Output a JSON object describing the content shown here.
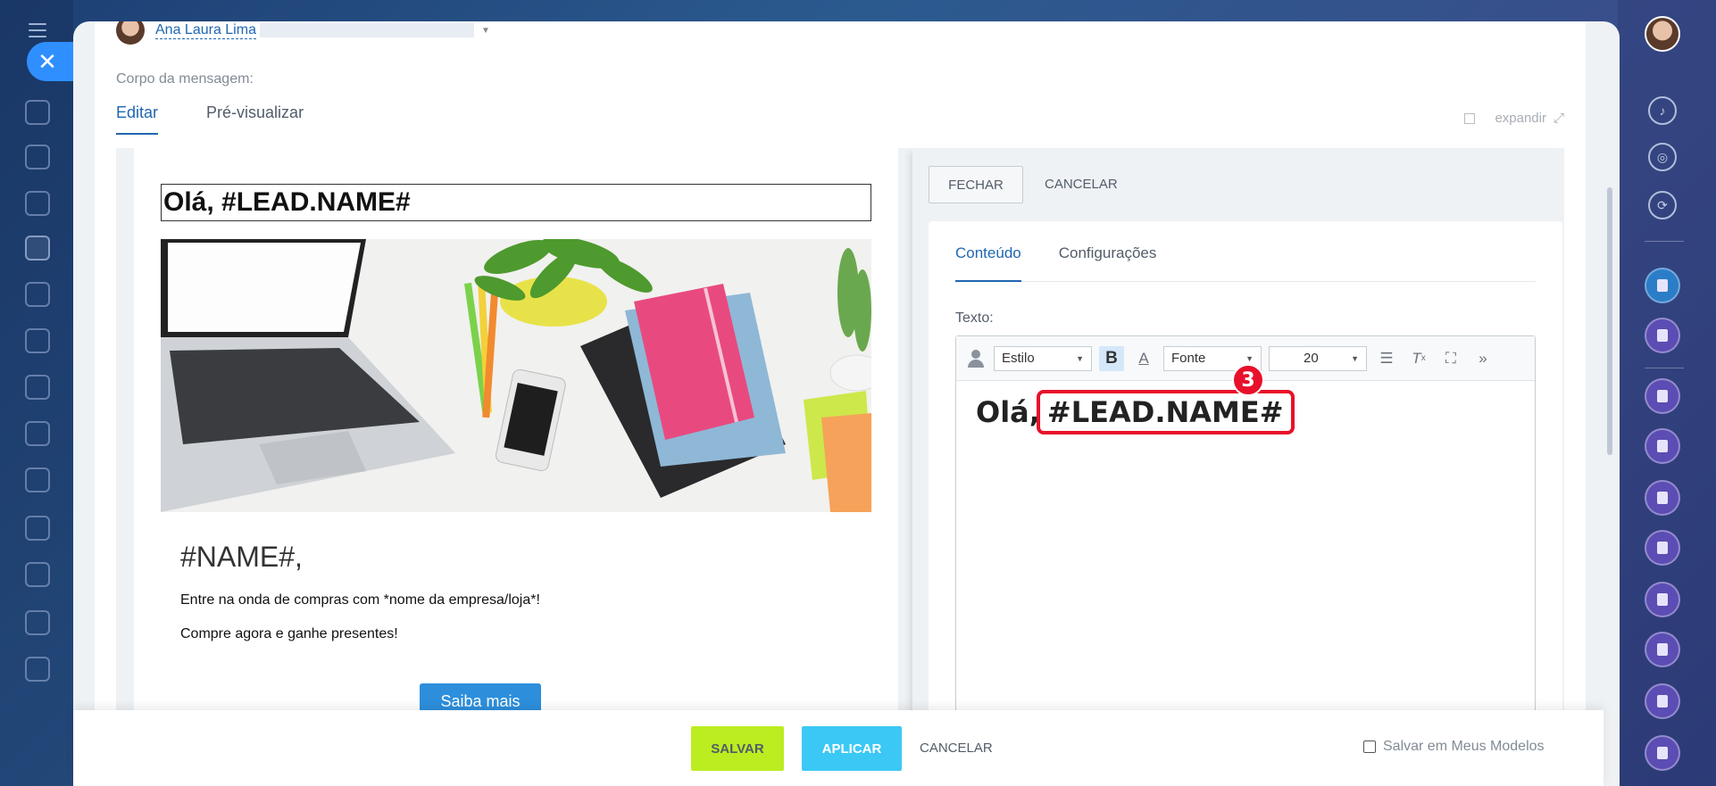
{
  "sender": {
    "name": "Ana Laura Lima"
  },
  "message": {
    "body_label": "Corpo da mensagem:",
    "tabs": [
      {
        "label": "Editar"
      },
      {
        "label": "Pré-visualizar"
      }
    ],
    "expand_label": "expandir"
  },
  "email": {
    "heading": "Olá, #LEAD.NAME#",
    "name_line": "#NAME#,",
    "line1": "Entre na onda de compras com *nome da empresa/loja*!",
    "line2": "Compre agora e ganhe presentes!",
    "cta": "Saiba mais"
  },
  "side_panel": {
    "close_label": "FECHAR",
    "cancel_label": "CANCELAR",
    "tabs": [
      {
        "label": "Conteúdo"
      },
      {
        "label": "Configurações"
      }
    ],
    "text_label": "Texto:",
    "toolbar": {
      "style": "Estilo",
      "font": "Fonte",
      "size": "20"
    },
    "content_prefix": "Olá,",
    "content_tag": "#LEAD.NAME#",
    "step_badge": "3"
  },
  "footer": {
    "save": "SALVAR",
    "apply": "APLICAR",
    "cancel": "CANCELAR",
    "save_templates": "Salvar em Meus Modelos"
  },
  "colors": {
    "accent": "#2067b0",
    "save_button": "#bbed21",
    "apply_button": "#3bc8f5",
    "highlight": "#e8102a"
  }
}
